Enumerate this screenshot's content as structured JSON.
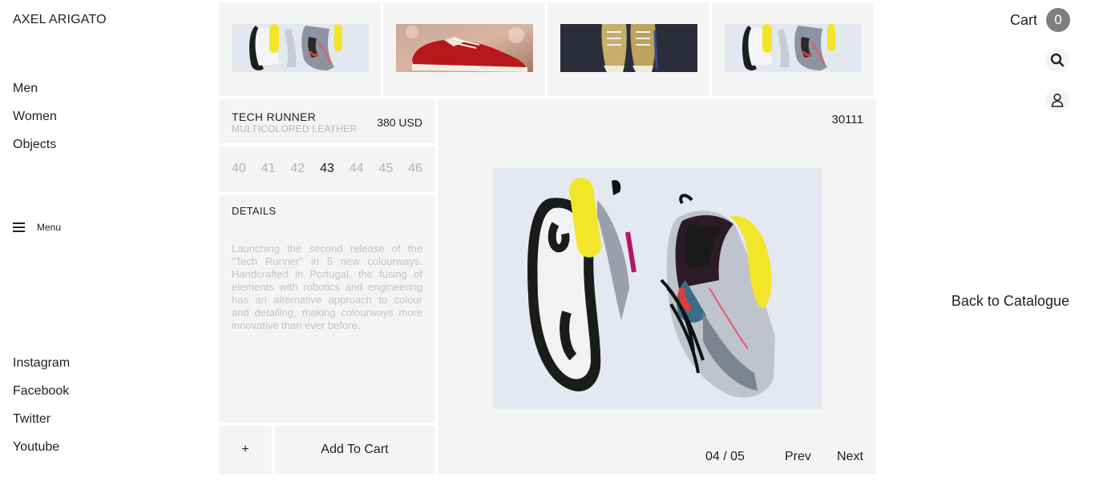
{
  "brand": "AXEL ARIGATO",
  "nav": [
    "Men",
    "Women",
    "Objects"
  ],
  "menu_label": "Menu",
  "social": [
    "Instagram",
    "Facebook",
    "Twitter",
    "Youtube"
  ],
  "product": {
    "name": "TECH RUNNER",
    "subtitle": "MULTICOLORED LEATHER",
    "price": "380 USD",
    "sizes": [
      "40",
      "41",
      "42",
      "43",
      "44",
      "45",
      "46"
    ],
    "selected_size": "43",
    "details_title": "DETAILS",
    "details_text": "Launching the second release of the \"Tech Runner\" in 5 new colourways. Handcrafted in Portugal, the fusing of elements with robotics and engineering has an alternative approach to colour and detailing, making colourways more innovative than ever before.",
    "sku": "30111"
  },
  "actions": {
    "plus": "+",
    "add_to_cart": "Add To Cart"
  },
  "pager": {
    "count": "04 / 05",
    "prev": "Prev",
    "next": "Next"
  },
  "cart": {
    "label": "Cart",
    "count": "0"
  },
  "back_link": "Back to Catalogue",
  "icons": [
    "search-icon",
    "user-icon",
    "menu-icon"
  ],
  "colors": {
    "panel_bg": "#f4f4f4",
    "muted_text": "#b7b7b7",
    "cart_badge": "#7f7f7f",
    "accent_yellow": "#f2e52a"
  }
}
